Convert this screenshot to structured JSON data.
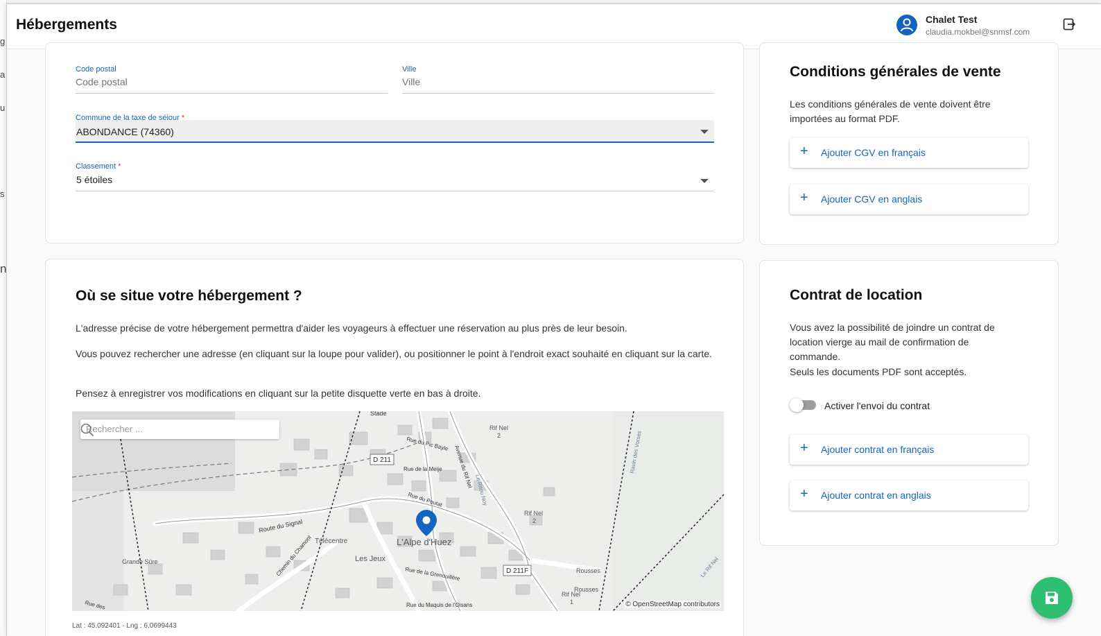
{
  "app": {
    "title": "Hébergements",
    "user": {
      "name": "Chalet Test",
      "email": "claudia.mokbel@snmsf.com"
    }
  },
  "form": {
    "postal_code": {
      "label": "Code postal",
      "placeholder": "Code postal",
      "value": ""
    },
    "city": {
      "label": "Ville",
      "placeholder": "Ville",
      "value": ""
    },
    "tax_commune": {
      "label": "Commune de la taxe de séjour",
      "required_mark": "*",
      "value": "ABONDANCE (74360)"
    },
    "rating": {
      "label": "Classement",
      "required_mark": "*",
      "value": "5 étoiles"
    }
  },
  "location": {
    "title": "Où se situe votre hébergement ?",
    "paragraphs": [
      "L'adresse précise de votre hébergement permettra d'aider les voyageurs à effectuer une réservation au plus près de leur besoin.",
      "Vous pouvez rechercher une adresse (en cliquant sur la loupe pour valider), ou positionner le point à l'endroit exact souhaité en cliquant sur la carte.",
      "Pensez à enregistrer vos modifications en cliquant sur la petite disquette verte en bas à droite."
    ],
    "map": {
      "search_placeholder": "Rechercher ...",
      "attribution": "© OpenStreetMap contributors",
      "labels": {
        "stade": "Stade",
        "d211": "D 211",
        "d211f": "D 211F",
        "rue_pic_bayle": "Rue du Pic Bayle",
        "rue_meije": "Rue de la Meije",
        "avenue_rif_nel": "Avenue du Rif Nel",
        "rue_poutat": "Rue du Poutat",
        "route_signal": "Route du Signal",
        "telecentre": "Télécentre",
        "alpe_huez": "L'Alpe d'Huez",
        "les_jeux": "Les Jeux",
        "chemin_chamont": "Chemin du Chamont",
        "rue_grenouillere": "Rue de la Grenouillère",
        "rue_maquis": "Rue du Maquis de l'Oisans",
        "grande_sure": "Grande Sûre",
        "rif_nel_1": "Rif Nel",
        "rif_nel_1_num": "2",
        "rif_nel_2": "Rif Nel",
        "rif_nel_2_num": "2",
        "rif_nel_3": "Rif Nel",
        "rif_nel_3_num": "1",
        "rousses_1": "Rousses",
        "rousses_2": "Rousses",
        "le_ritou": "Le Ritou Noy",
        "ravin_vorses": "Ravin des Vorses",
        "le_rif_nel": "Le Rif Nel",
        "rue_des": "Rue des"
      }
    },
    "coords_text": "Lat : 45.092401 - Lng : 6.0699443"
  },
  "cgv": {
    "title": "Conditions générales de vente",
    "description": "Les conditions générales de vente doivent être importées au format PDF.",
    "buttons": {
      "fr": "Ajouter CGV en français",
      "en": "Ajouter CGV en anglais"
    }
  },
  "contract": {
    "title": "Contrat de location",
    "description_1": "Vous avez la possibilité de joindre un contrat de location vierge au mail de confirmation de commande.",
    "description_2": "Seuls les documents PDF sont acceptés.",
    "toggle_label": "Activer l'envoi du contrat",
    "toggle_on": false,
    "buttons": {
      "fr": "Ajouter contrat en français",
      "en": "Ajouter contrat en anglais"
    }
  },
  "colors": {
    "accent": "#1565c0",
    "save": "#2fbf71",
    "required": "#d32f2f"
  },
  "icons": {
    "user": "account-circle-icon",
    "logout": "logout-icon",
    "search": "search-icon",
    "plus": "plus-icon",
    "pin": "map-pin-icon",
    "save": "floppy-disk-icon"
  }
}
